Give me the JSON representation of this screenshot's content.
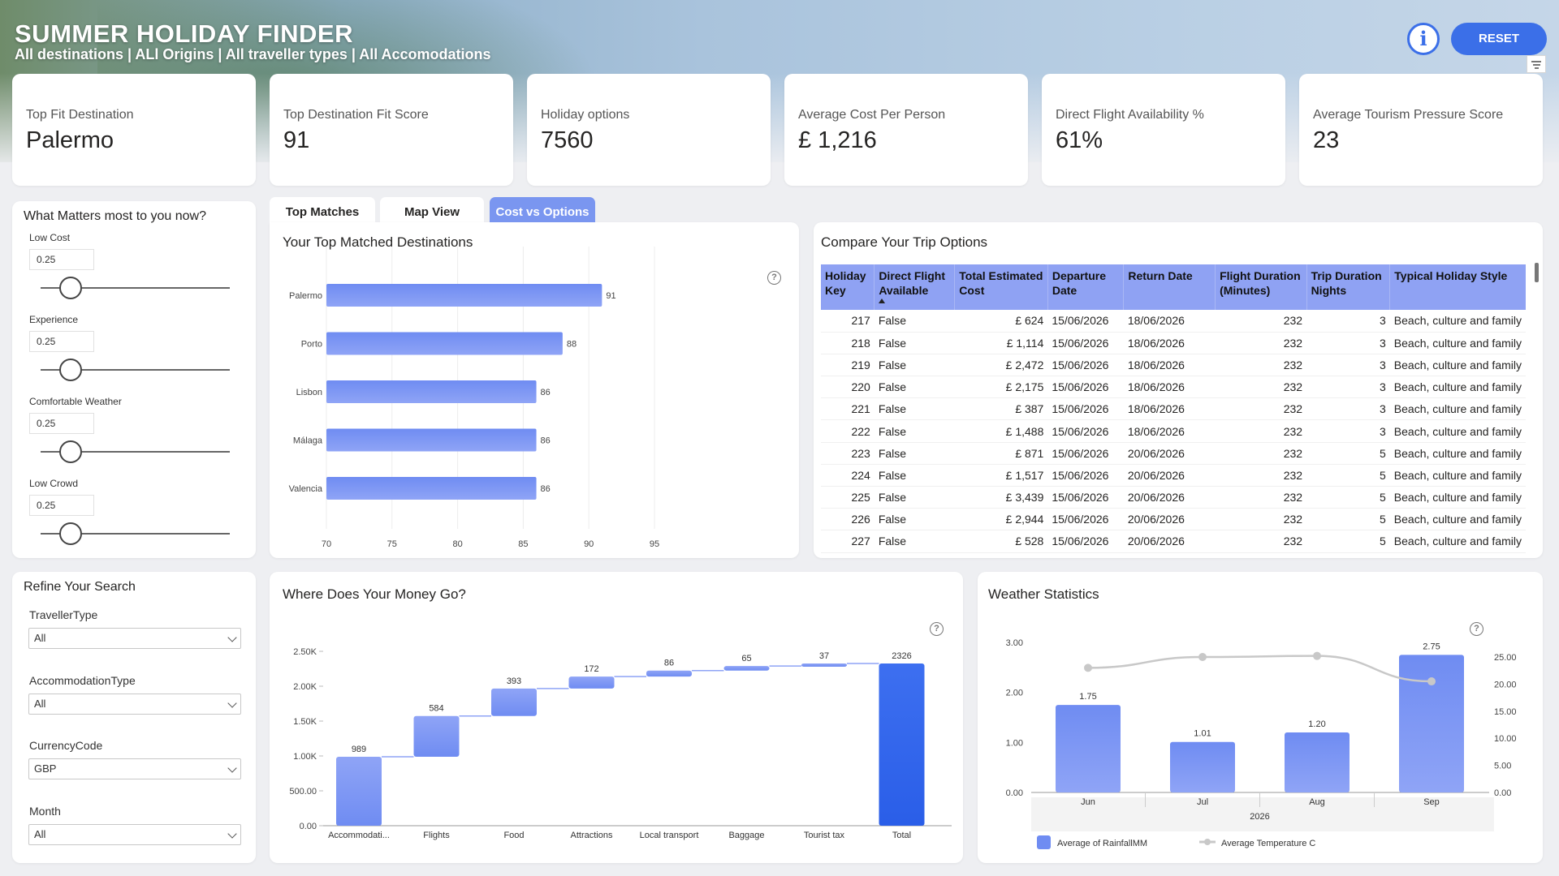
{
  "header": {
    "title": "SUMMER HOLIDAY FINDER",
    "subtitle": "All destinations | ALl Origins | All traveller types | All Accomodations",
    "info_icon": "info-icon",
    "reset_label": "RESET",
    "filter_icon": "filter-icon"
  },
  "kpis": [
    {
      "label": "Top Fit Destination",
      "value": "Palermo"
    },
    {
      "label": "Top Destination Fit Score",
      "value": "91"
    },
    {
      "label": "Holiday options",
      "value": "7560"
    },
    {
      "label": "Average Cost Per Person",
      "value": "£ 1,216"
    },
    {
      "label": "Direct Flight Availability %",
      "value": "61%"
    },
    {
      "label": "Average Tourism Pressure Score",
      "value": "23"
    }
  ],
  "preferences": {
    "title": "What Matters most to you now?",
    "sliders": [
      {
        "label": "Low Cost",
        "value": "0.25",
        "level": 0.25
      },
      {
        "label": "Experience",
        "value": "0.25",
        "level": 0.25
      },
      {
        "label": "Comfortable Weather",
        "value": "0.25",
        "level": 0.25
      },
      {
        "label": "Low Crowd",
        "value": "0.25",
        "level": 0.25
      }
    ]
  },
  "tabs": [
    {
      "label": "Top Matches",
      "active": false
    },
    {
      "label": "Map View",
      "active": false
    },
    {
      "label": "Cost vs Options",
      "active": true
    }
  ],
  "top_matches": {
    "title": "Your Top Matched Destinations",
    "help_icon": "help-icon"
  },
  "trip_table": {
    "title": "Compare Your Trip Options",
    "columns": [
      "Holiday Key",
      "Direct Flight Available",
      "Total Estimated Cost",
      "Departure Date",
      "Return Date",
      "Flight Duration (Minutes)",
      "Trip Duration Nights",
      "Typical Holiday Style"
    ],
    "rows": [
      [
        "217",
        "False",
        "£ 624",
        "15/06/2026",
        "18/06/2026",
        "232",
        "3",
        "Beach, culture and family"
      ],
      [
        "218",
        "False",
        "£ 1,114",
        "15/06/2026",
        "18/06/2026",
        "232",
        "3",
        "Beach, culture and family"
      ],
      [
        "219",
        "False",
        "£ 2,472",
        "15/06/2026",
        "18/06/2026",
        "232",
        "3",
        "Beach, culture and family"
      ],
      [
        "220",
        "False",
        "£ 2,175",
        "15/06/2026",
        "18/06/2026",
        "232",
        "3",
        "Beach, culture and family"
      ],
      [
        "221",
        "False",
        "£ 387",
        "15/06/2026",
        "18/06/2026",
        "232",
        "3",
        "Beach, culture and family"
      ],
      [
        "222",
        "False",
        "£ 1,488",
        "15/06/2026",
        "18/06/2026",
        "232",
        "3",
        "Beach, culture and family"
      ],
      [
        "223",
        "False",
        "£ 871",
        "15/06/2026",
        "20/06/2026",
        "232",
        "5",
        "Beach, culture and family"
      ],
      [
        "224",
        "False",
        "£ 1,517",
        "15/06/2026",
        "20/06/2026",
        "232",
        "5",
        "Beach, culture and family"
      ],
      [
        "225",
        "False",
        "£ 3,439",
        "15/06/2026",
        "20/06/2026",
        "232",
        "5",
        "Beach, culture and family"
      ],
      [
        "226",
        "False",
        "£ 2,944",
        "15/06/2026",
        "20/06/2026",
        "232",
        "5",
        "Beach, culture and family"
      ],
      [
        "227",
        "False",
        "£ 528",
        "15/06/2026",
        "20/06/2026",
        "232",
        "5",
        "Beach, culture and family"
      ]
    ]
  },
  "refine": {
    "title": "Refine Your Search",
    "filters": [
      {
        "label": "TravellerType",
        "value": "All"
      },
      {
        "label": "AccommodationType",
        "value": "All"
      },
      {
        "label": "CurrencyCode",
        "value": "GBP"
      },
      {
        "label": "Month",
        "value": "All"
      }
    ]
  },
  "money": {
    "title": "Where Does Your Money Go?"
  },
  "weather": {
    "title": "Weather Statistics"
  },
  "colors": {
    "accent": "#3b6fe8",
    "bar": "#6f8cf2",
    "bar_light": "#8fa4f6",
    "table_header": "#8fa2f3",
    "line": "#c8c8c8"
  },
  "chart_data": [
    {
      "type": "bar",
      "title": "Your Top Matched Destinations",
      "orientation": "horizontal",
      "categories": [
        "Palermo",
        "Porto",
        "Lisbon",
        "Málaga",
        "Valencia"
      ],
      "values": [
        91,
        88,
        86,
        86,
        86
      ],
      "xlim": [
        70,
        95
      ],
      "xticks": [
        70,
        75,
        80,
        85,
        90,
        95
      ],
      "grid": true
    },
    {
      "type": "bar",
      "subtype": "waterfall",
      "title": "Where Does Your Money Go?",
      "categories": [
        "Accommodati...",
        "Flights",
        "Food",
        "Attractions",
        "Local transport",
        "Baggage",
        "Tourist tax",
        "Total"
      ],
      "values": [
        989,
        584,
        393,
        172,
        86,
        65,
        37,
        2326
      ],
      "ylim": [
        0,
        2500
      ],
      "yticks": [
        "0.00",
        "500.00",
        "1.00K",
        "1.50K",
        "2.00K",
        "2.50K"
      ]
    },
    {
      "type": "bar",
      "subtype": "bar+line",
      "title": "Weather Statistics",
      "categories": [
        "Jun",
        "Jul",
        "Aug",
        "Sep"
      ],
      "x_group_label": "2026",
      "series": [
        {
          "name": "Average of RainfallMM",
          "type": "bar",
          "axis": "left",
          "values": [
            1.75,
            1.01,
            1.2,
            2.75
          ],
          "labels": [
            "1.75",
            "1.01",
            "1.20",
            "2.75"
          ]
        },
        {
          "name": "Average Temperature C",
          "type": "line",
          "axis": "right",
          "values": [
            23.0,
            25.0,
            25.2,
            20.5
          ]
        }
      ],
      "ylim_left": [
        0,
        3
      ],
      "yticks_left": [
        "0.00",
        "1.00",
        "2.00",
        "3.00"
      ],
      "ylim_right": [
        0,
        25
      ],
      "yticks_right": [
        "0.00",
        "5.00",
        "10.00",
        "15.00",
        "20.00",
        "25.00"
      ],
      "legend": "bottom-left"
    }
  ]
}
